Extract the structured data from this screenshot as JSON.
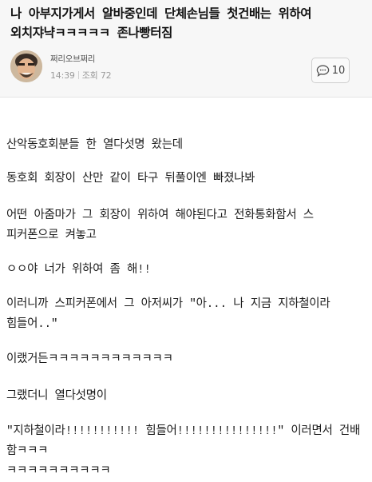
{
  "post": {
    "title": "나 아부지가게서 알바중인데 단체손님들 첫건배는 위하여\n외치쟈냑ㅋㅋㅋㅋㅋ 존나빵터짐",
    "author": "쩌리오브쩌리",
    "time": "14:39",
    "views_label": "조회 72",
    "comment_count": "10",
    "icons": {
      "avatar": "avatar-photo",
      "comment": "speech-bubble-icon"
    }
  },
  "body": {
    "paragraphs": [
      "산악동호회분들 한 열다섯명 왔는데",
      "동호회 회장이 산만 같이 타구 뒤풀이엔 빠졌나봐",
      "어떤 아줌마가 그 회장이 위하여 해야된다고 전화통화함서 스\n피커폰으로 켜놓고",
      "ㅇㅇ야 너가 위하여 좀 해!!",
      "이러니까 스피커폰에서 그 아저씨가 \"아... 나 지금 지하철이라\n힘들어..\"",
      "이랬거든ㅋㅋㅋㅋㅋㅋㅋㅋㅋㅋㅋㅋ",
      "그랬더니 열다섯명이",
      "\"지하철이라!!!!!!!!!!! 힘들어!!!!!!!!!!!!!!!\" 이러면서 건배함ㅋㅋㅋ\nㅋㅋㅋㅋㅋㅋㅋㅋㅋㅋ"
    ]
  }
}
